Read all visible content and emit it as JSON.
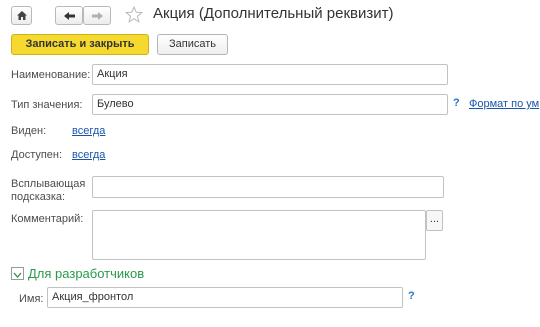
{
  "window": {
    "title": "Акция (Дополнительный реквизит)"
  },
  "toolbar": {
    "primary_label": "Записать и закрыть",
    "secondary_label": "Записать"
  },
  "form": {
    "name_label": "Наименование:",
    "name_value": "Акция",
    "type_label": "Тип значения:",
    "type_value": "Булево",
    "format_link": "Формат по ум",
    "help_mark": "?",
    "visible_label": "Виден:",
    "visible_value": "всегда",
    "available_label": "Доступен:",
    "available_value": "всегда",
    "tooltip_label_1": "Всплывающая",
    "tooltip_label_2": "подсказка:",
    "tooltip_value": "",
    "comment_label": "Комментарий:",
    "comment_value": "",
    "comment_button": "..."
  },
  "developers": {
    "section_label": "Для разработчиков",
    "name_label": "Имя:",
    "name_value": "Акция_фронтол",
    "help_mark": "?"
  },
  "icons": {
    "home": "home-icon",
    "back": "arrow-left-icon",
    "forward": "arrow-right-icon",
    "favorite": "star-icon",
    "toggle": "chevron-down-icon"
  }
}
